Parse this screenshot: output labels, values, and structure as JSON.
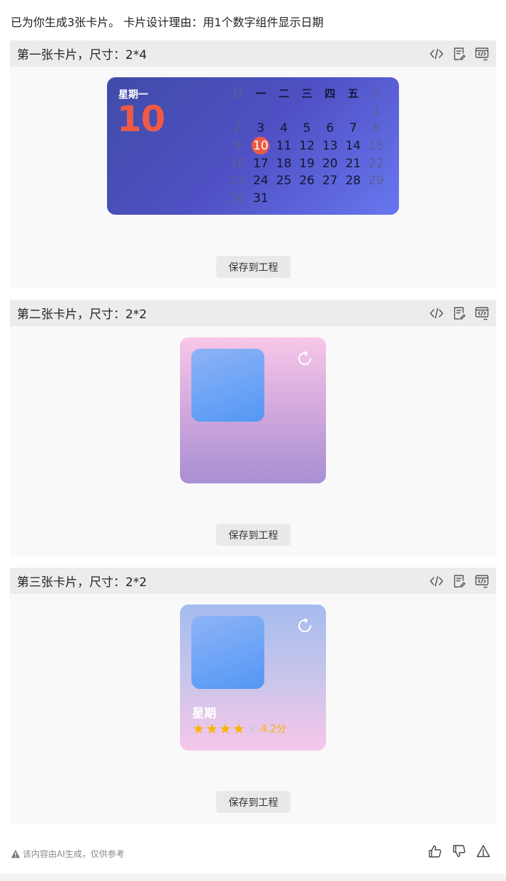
{
  "intro": "已为你生成3张卡片。 卡片设计理由：用1个数字组件显示日期",
  "cards": [
    {
      "title": "第一张卡片，尺寸：2*4",
      "save_label": "保存到工程"
    },
    {
      "title": "第二张卡片，尺寸：2*2",
      "save_label": "保存到工程"
    },
    {
      "title": "第三张卡片，尺寸：2*2",
      "save_label": "保存到工程"
    }
  ],
  "calendar": {
    "weekday": "星期一",
    "day": "10",
    "headers": [
      "日",
      "一",
      "二",
      "三",
      "四",
      "五",
      "六"
    ],
    "days": [
      "",
      "",
      "",
      "",
      "",
      "",
      "1",
      "2",
      "3",
      "4",
      "5",
      "6",
      "7",
      "8",
      "9",
      "10",
      "11",
      "12",
      "13",
      "14",
      "15",
      "16",
      "17",
      "18",
      "19",
      "20",
      "21",
      "22",
      "23",
      "24",
      "25",
      "26",
      "27",
      "28",
      "29",
      "30",
      "31"
    ],
    "today": "10",
    "accent_color": "#ef5a45"
  },
  "card3": {
    "label": "星期",
    "rating_value": 4.2,
    "rating_text": "4.2分",
    "stars_filled": 4,
    "stars_total": 5
  },
  "toolbar_icons": [
    "code-icon",
    "document-edit-icon",
    "code-preview-icon"
  ],
  "footer": {
    "disclaimer": "该内容由AI生成，仅供参考",
    "icons": [
      "thumbs-up-icon",
      "thumbs-down-icon",
      "report-icon"
    ]
  }
}
